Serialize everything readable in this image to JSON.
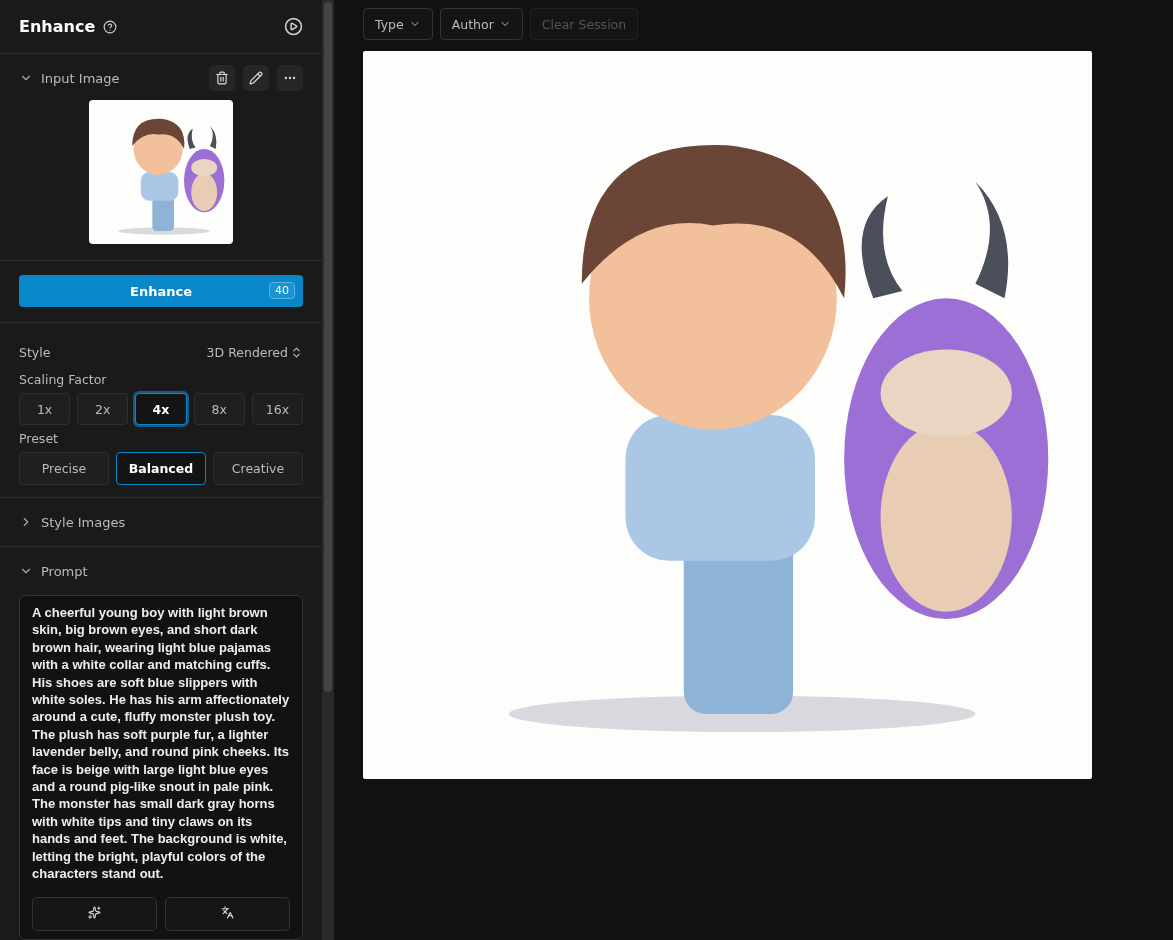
{
  "header": {
    "title": "Enhance"
  },
  "input_image": {
    "title": "Input Image",
    "expanded": true
  },
  "enhance_button": {
    "label": "Enhance",
    "credits": "40"
  },
  "style": {
    "label": "Style",
    "value": "3D Rendered"
  },
  "scaling_factor": {
    "label": "Scaling Factor",
    "options": [
      {
        "label": "1x",
        "selected": false
      },
      {
        "label": "2x",
        "selected": false
      },
      {
        "label": "4x",
        "selected": true
      },
      {
        "label": "8x",
        "selected": false
      },
      {
        "label": "16x",
        "selected": false
      }
    ]
  },
  "preset": {
    "label": "Preset",
    "options": [
      {
        "label": "Precise",
        "selected": false
      },
      {
        "label": "Balanced",
        "selected": true
      },
      {
        "label": "Creative",
        "selected": false
      }
    ]
  },
  "style_images": {
    "title": "Style Images",
    "expanded": false
  },
  "prompt": {
    "title": "Prompt",
    "expanded": true,
    "text": "A cheerful young boy with light brown skin, big brown eyes, and short dark brown hair, wearing light blue pajamas with a white collar and matching cuffs. His shoes are soft blue slippers with white soles. He has his arm affectionately around a cute, fluffy monster plush toy. The plush has soft purple fur, a lighter lavender belly, and round pink cheeks. Its face is beige with large light blue eyes and a round pig-like snout in pale pink. The monster has small dark gray horns with white tips and tiny claws on its hands and feet. The background is white, letting the bright, playful colors of the characters stand out."
  },
  "toolbar": {
    "filters": [
      {
        "label": "Type"
      },
      {
        "label": "Author"
      }
    ],
    "clear_button": {
      "label": "Clear Session",
      "disabled": true
    }
  }
}
